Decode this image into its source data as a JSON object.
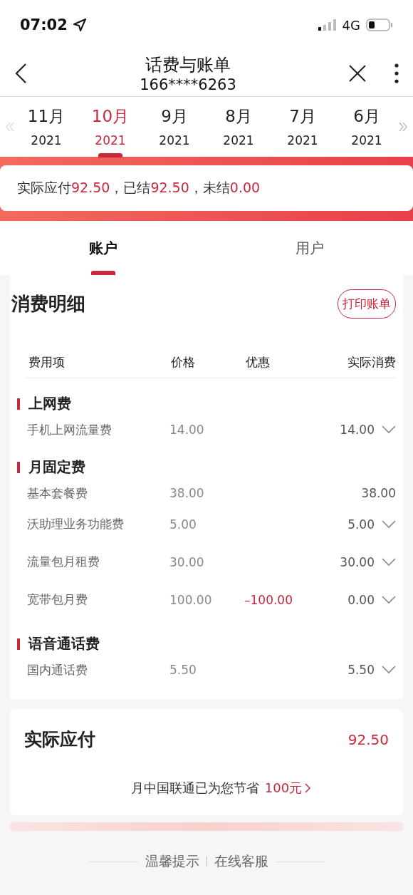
{
  "status_bar": {
    "time": "07:02",
    "network": "4G"
  },
  "header": {
    "title": "话费与账单",
    "subtitle": "166****6263"
  },
  "months": [
    {
      "month": "11月",
      "year": "2021",
      "selected": false
    },
    {
      "month": "10月",
      "year": "2021",
      "selected": true
    },
    {
      "month": "9月",
      "year": "2021",
      "selected": false
    },
    {
      "month": "8月",
      "year": "2021",
      "selected": false
    },
    {
      "month": "7月",
      "year": "2021",
      "selected": false
    },
    {
      "month": "6月",
      "year": "2021",
      "selected": false
    }
  ],
  "summary": [
    {
      "label": "实际应付",
      "amount": "92.50"
    },
    {
      "label": "，已结",
      "amount": "92.50"
    },
    {
      "label": "，未结",
      "amount": "0.00"
    }
  ],
  "tabs": [
    {
      "label": "账户",
      "selected": true
    },
    {
      "label": "用户",
      "selected": false
    }
  ],
  "detail": {
    "title": "消费明细",
    "print_button": "打印账单",
    "columns": [
      "费用项",
      "价格",
      "优惠",
      "实际消费"
    ],
    "groups": [
      {
        "name": "上网费",
        "children": [
          {
            "name": "手机上网流量费",
            "price": "14.00",
            "actual": "14.00",
            "expandable": true
          }
        ]
      },
      {
        "name": "月固定费",
        "children": [
          {
            "name": "基本套餐费",
            "price": "38.00",
            "actual": "38.00",
            "expandable": false
          },
          {
            "name": "沃助理业务功能费",
            "price": "5.00",
            "actual": "5.00",
            "expandable": true
          },
          {
            "name": "流量包月租费",
            "price": "30.00",
            "actual": "30.00",
            "expandable": true
          },
          {
            "name": "宽带包月费",
            "price": "100.00",
            "discount": "–100.00",
            "actual": "0.00",
            "expandable": true
          }
        ]
      },
      {
        "name": "语音通话费",
        "children": [
          {
            "name": "国内通话费",
            "price": "5.50",
            "actual": "5.50",
            "expandable": true
          }
        ]
      }
    ]
  },
  "total": {
    "label": "实际应付",
    "amount": "92.50",
    "savings_text": "月中国联通已为您节省",
    "savings_link": "100元"
  },
  "footer": [
    "温馨提示",
    "在线客服"
  ]
}
